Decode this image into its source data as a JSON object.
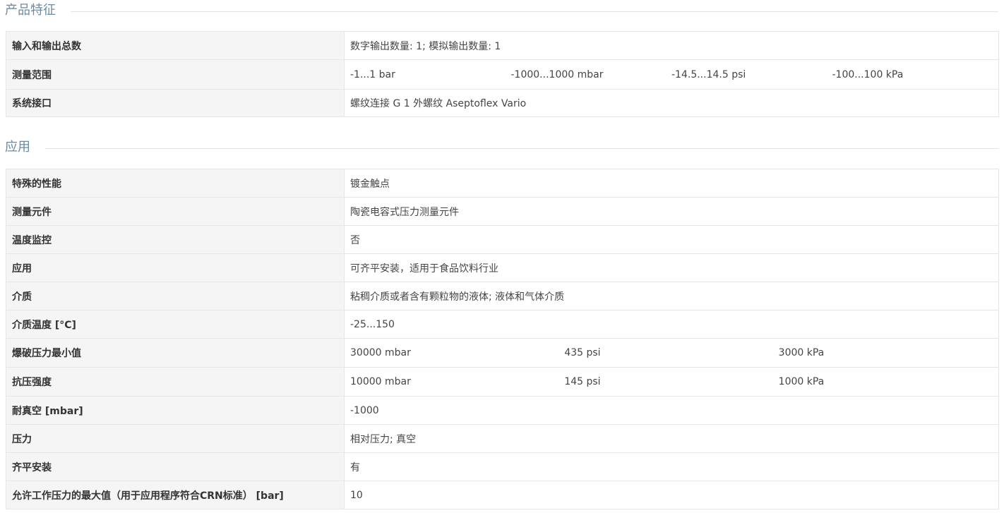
{
  "sections": [
    {
      "title": "产品特征",
      "rows": [
        {
          "label": "输入和输出总数",
          "value": "数字输出数量: 1; 模拟输出数量: 1"
        },
        {
          "label": "测量范围",
          "values": [
            "-1...1 bar",
            "-1000...1000 mbar",
            "-14.5...14.5 psi",
            "-100...100 kPa"
          ]
        },
        {
          "label": "系统接口",
          "value": "螺纹连接 G 1 外螺纹 Aseptoflex Vario"
        }
      ]
    },
    {
      "title": "应用",
      "rows": [
        {
          "label": "特殊的性能",
          "value": "镀金触点"
        },
        {
          "label": "测量元件",
          "value": "陶瓷电容式压力测量元件"
        },
        {
          "label": "温度监控",
          "value": "否"
        },
        {
          "label": "应用",
          "value": "可齐平安装，适用于食品饮料行业"
        },
        {
          "label": "介质",
          "value": "粘稠介质或者含有颗粒物的液体; 液体和气体介质"
        },
        {
          "label": "介质温度 [°C]",
          "value": "-25...150"
        },
        {
          "label": "爆破压力最小值",
          "values": [
            "30000 mbar",
            "435 psi",
            "3000 kPa"
          ]
        },
        {
          "label": "抗压强度",
          "values": [
            "10000 mbar",
            "145 psi",
            "1000 kPa"
          ]
        },
        {
          "label": "耐真空 [mbar]",
          "value": "-1000"
        },
        {
          "label": "压力",
          "value": "相对压力; 真空"
        },
        {
          "label": "齐平安装",
          "value": "有"
        },
        {
          "label": "允许工作压力的最大值（用于应用程序符合CRN标准） [bar]",
          "value": "10"
        }
      ]
    }
  ]
}
